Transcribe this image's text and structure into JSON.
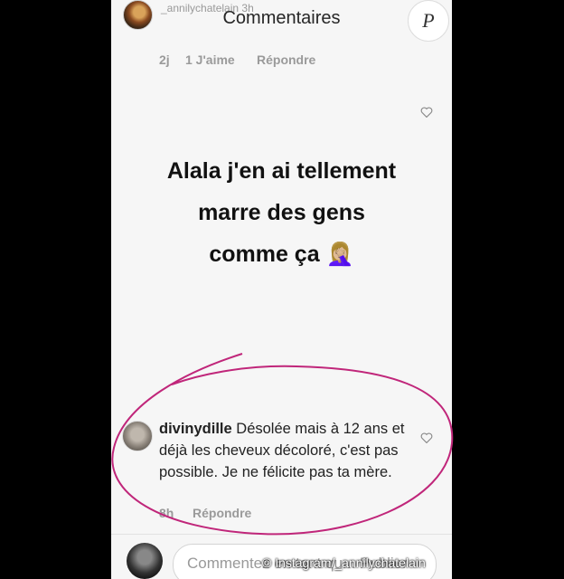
{
  "header": {
    "story_user": "_annilychatelain 3h",
    "title": "Commentaires"
  },
  "prev_comment": {
    "age": "2j",
    "likes": "1 J'aime",
    "reply": "Répondre"
  },
  "caption": {
    "lines": [
      "Alala j'en ai tellement",
      "marre des gens",
      "comme ça 🤦🏼‍♀️"
    ]
  },
  "comment": {
    "username": "divinydille",
    "text": "Désolée mais à 12 ans et déjà les cheveux décoloré, c'est pas possible. Je ne félicite pas ta mère.",
    "age": "8h",
    "reply": "Répondre"
  },
  "input": {
    "placeholder": "Commentez en tant qu... Publier"
  },
  "watermark": "© Instagram/_annilychatelain",
  "logo_letter": "P",
  "colors": {
    "annotation_circle": "#c0267a",
    "background": "#f6f6f6"
  },
  "icons": [
    "heart-icon",
    "avatar",
    "logo"
  ]
}
